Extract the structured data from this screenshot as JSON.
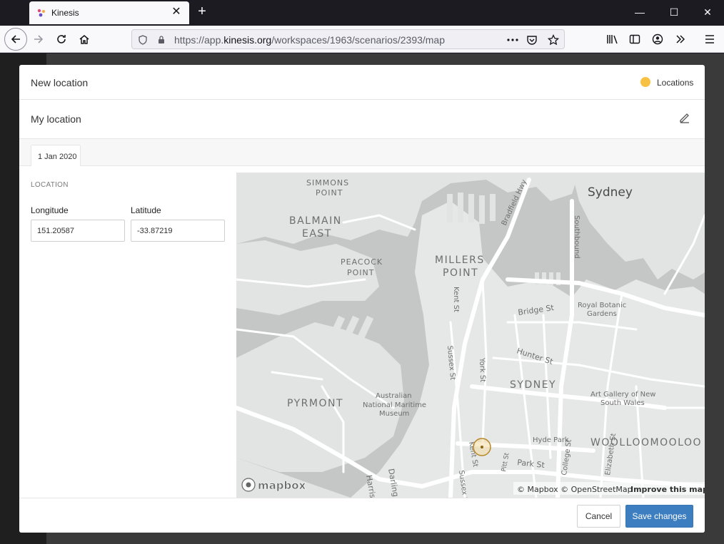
{
  "browser": {
    "tab_title": "Kinesis",
    "url_prefix": "https://app.",
    "url_domain": "kinesis.org",
    "url_path": "/workspaces/1963/scenarios/2393/map",
    "tab_close_glyph": "✕",
    "new_tab_glyph": "+",
    "minimize_glyph": "—",
    "maximize_glyph": "☐",
    "close_glyph": "✕"
  },
  "modal": {
    "title": "New location",
    "layer": {
      "label": "Locations",
      "color": "#f7c244"
    },
    "name": "My location",
    "tabs": [
      {
        "label": "1 Jan 2020"
      }
    ],
    "section_label": "LOCATION",
    "longitude": {
      "label": "Longitude",
      "value": "151.20587"
    },
    "latitude": {
      "label": "Latitude",
      "value": "-33.87219"
    },
    "cancel_label": "Cancel",
    "save_label": "Save changes"
  },
  "map": {
    "labels": {
      "sydney_city": "Sydney",
      "simmons": "SIMMONS",
      "simmons_point": "POINT",
      "balmain": "BALMAIN",
      "balmain_east": "EAST",
      "peacock": "PEACOCK",
      "peacock_point": "POINT",
      "millers": "MILLERS",
      "millers_point": "POINT",
      "pyrmont": "PYRMONT",
      "sydney_suburb": "SYDNEY",
      "woolloomooloo": "WOOLLOOMOOLOO",
      "royal": "Royal Botanic",
      "gardens": "Gardens",
      "art_gallery": "Art Gallery of New",
      "south_wales": "South Wales",
      "museum1": "Australian",
      "museum2": "National Maritime",
      "museum3": "Museum",
      "hyde_park": "Hyde Park",
      "bradfield": "Bradfield Hwy",
      "southbound": "Southbound",
      "kent_st_1": "Kent St",
      "kent_st_2": "Kent St",
      "bridge_st": "Bridge St",
      "hunter_st": "Hunter St",
      "sussex_st_1": "Sussex St",
      "sussex_st_2": "Sussex St",
      "york_st": "York St",
      "park_st": "Park St",
      "pitt_st": "Pitt St",
      "college_st": "College St",
      "elizabeth_st": "Elizabeth St",
      "harris": "Harris",
      "darling": "Darling"
    },
    "logo_text": "mapbox",
    "attribution": "© Mapbox © OpenStreetMap",
    "improve": "Improve this map"
  }
}
